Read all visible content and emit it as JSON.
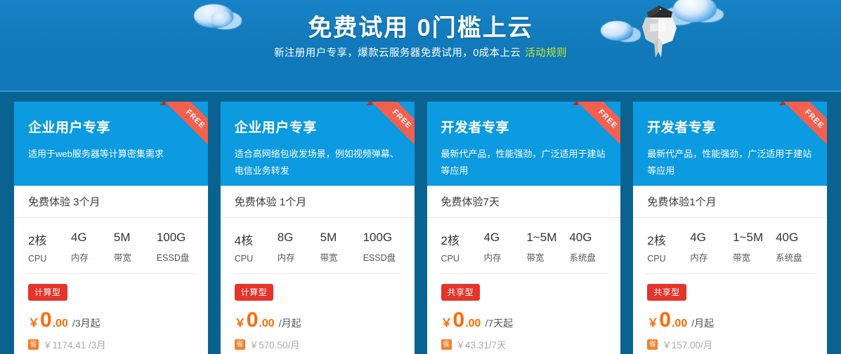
{
  "banner": {
    "title": "免费试用 0门槛上云",
    "subtitle": "新注册用户专享，爆款云服务器免费试用，0成本上云",
    "rule_link": "活动规则",
    "link_color": "#c9ea2b",
    "bg_color": "#1179b9"
  },
  "page": {
    "section_bg": "#0a6291",
    "card_header_bg": "#0c9ae0",
    "ribbon_color": "#f2604f",
    "price_color": "#ff6a00",
    "type_badge_color": "#e4342b",
    "save_badge_color": "#f7802c"
  },
  "cards": [
    {
      "title": "企业用户专享",
      "desc": "适用于web服务器等计算密集需求",
      "ribbon": "FREE",
      "trial": "免费体验 3个月",
      "specs": [
        {
          "value": "2核",
          "label": "CPU"
        },
        {
          "value": "4G",
          "label": "内存"
        },
        {
          "value": "5M",
          "label": "带宽"
        },
        {
          "value": "100G",
          "label": "ESSD盘"
        }
      ],
      "type_badge": "计算型",
      "currency": "￥",
      "price_int": "0",
      "price_cents": ".00",
      "price_unit": "/3月起",
      "save_badge": "省",
      "old_price": "￥1174.41 /3月"
    },
    {
      "title": "企业用户专享",
      "desc": "适合高网络包收发场景，例如视频弹幕、电信业务转发",
      "ribbon": "FREE",
      "trial": "免费体验 1个月",
      "specs": [
        {
          "value": "4核",
          "label": "CPU"
        },
        {
          "value": "8G",
          "label": "内存"
        },
        {
          "value": "5M",
          "label": "带宽"
        },
        {
          "value": "100G",
          "label": "ESSD盘"
        }
      ],
      "type_badge": "计算型",
      "currency": "￥",
      "price_int": "0",
      "price_cents": ".00",
      "price_unit": "/月起",
      "save_badge": "省",
      "old_price": "￥570.50/月"
    },
    {
      "title": "开发者专享",
      "desc": "最新代产品，性能强劲，广泛适用于建站等应用",
      "ribbon": "FREE",
      "trial": "免费体验7天",
      "specs": [
        {
          "value": "2核",
          "label": "CPU"
        },
        {
          "value": "4G",
          "label": "内存"
        },
        {
          "value": "1~5M",
          "label": "带宽"
        },
        {
          "value": "40G",
          "label": "系统盘"
        }
      ],
      "type_badge": "共享型",
      "currency": "￥",
      "price_int": "0",
      "price_cents": ".00",
      "price_unit": "/7天起",
      "save_badge": "省",
      "old_price": "￥43.31/7天"
    },
    {
      "title": "开发者专享",
      "desc": "最新代产品，性能强劲，广泛适用于建站等应用",
      "ribbon": "FREE",
      "trial": "免费体验1个月",
      "specs": [
        {
          "value": "2核",
          "label": "CPU"
        },
        {
          "value": "4G",
          "label": "内存"
        },
        {
          "value": "1~5M",
          "label": "带宽"
        },
        {
          "value": "40G",
          "label": "系统盘"
        }
      ],
      "type_badge": "共享型",
      "currency": "￥",
      "price_int": "0",
      "price_cents": ".00",
      "price_unit": "/月起",
      "save_badge": "省",
      "old_price": "￥157.00/月"
    }
  ]
}
